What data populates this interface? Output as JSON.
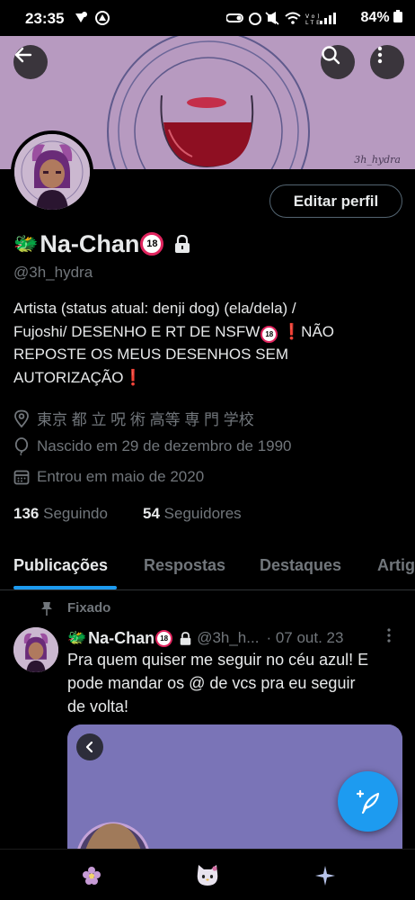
{
  "status_bar": {
    "time": "23:35",
    "battery": "84%"
  },
  "banner": {
    "signature": "3h_hydra"
  },
  "profile_header": {
    "edit_label": "Editar perfil"
  },
  "profile": {
    "display_name": "Na-Chan",
    "badge_text": "18",
    "handle": "@3h_hydra",
    "bio_line1": "Artista (status atual: denji dog)  (ela/dela)  /",
    "bio_line2_a": "Fujoshi/  DESENHO E RT DE NSFW",
    "bio_line2_b": "NÃO",
    "bio_line3": "REPOSTE OS MEUS DESENHOS SEM",
    "bio_line4": "AUTORIZAÇÃO",
    "location": "東京 都 立 呪 術 高等 専 門 学校",
    "birthday": "Nascido em 29 de dezembro de 1990",
    "joined": "Entrou em maio de 2020",
    "following_count": "136",
    "following_label": "Seguindo",
    "followers_count": "54",
    "followers_label": "Seguidores"
  },
  "tabs": [
    {
      "label": "Publicações",
      "active": true
    },
    {
      "label": "Respostas",
      "active": false
    },
    {
      "label": "Destaques",
      "active": false
    },
    {
      "label": "Artigos",
      "active": false
    }
  ],
  "pinned_post": {
    "pinned_label": "Fixado",
    "author_name": "Na-Chan",
    "author_handle": "@3h_h...",
    "date": "· 07 out. 23",
    "text_line1": "Pra quem quiser me seguir no céu azul! E",
    "text_line2": "pode mandar os @ de vcs pra eu seguir",
    "text_line3": "de volta!"
  },
  "icons": {
    "back": "arrow-left-icon",
    "search": "search-icon",
    "more": "more-vertical-icon",
    "lock": "lock-icon",
    "location": "location-pin-icon",
    "birthday": "balloon-icon",
    "calendar": "calendar-icon",
    "pin": "pin-icon",
    "compose": "compose-feather-icon"
  },
  "colors": {
    "accent": "#1d9bf0",
    "background": "#000000",
    "banner": "#b79ac0",
    "secondary_text": "#71767b",
    "alert_red": "#f4212e"
  }
}
